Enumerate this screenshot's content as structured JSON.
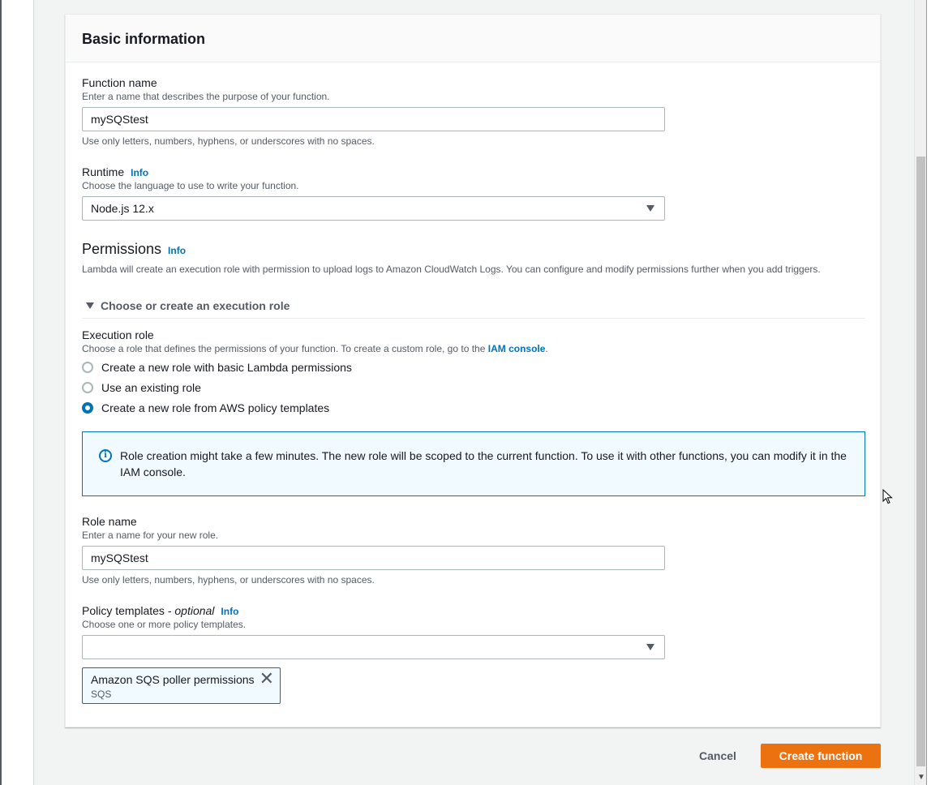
{
  "basic_info": {
    "title": "Basic information"
  },
  "function_name": {
    "label": "Function name",
    "description": "Enter a name that describes the purpose of your function.",
    "value": "mySQStest",
    "constraint": "Use only letters, numbers, hyphens, or underscores with no spaces."
  },
  "runtime": {
    "label": "Runtime",
    "info": "Info",
    "description": "Choose the language to use to write your function.",
    "value": "Node.js 12.x"
  },
  "permissions": {
    "title": "Permissions",
    "info": "Info",
    "description": "Lambda will create an execution role with permission to upload logs to Amazon CloudWatch Logs. You can configure and modify permissions further when you add triggers.",
    "expander_label": "Choose or create an execution role"
  },
  "execution_role": {
    "label": "Execution role",
    "description_prefix": "Choose a role that defines the permissions of your function. To create a custom role, go to the ",
    "description_link": "IAM console",
    "description_suffix": ".",
    "options": [
      {
        "label": "Create a new role with basic Lambda permissions",
        "selected": false
      },
      {
        "label": "Use an existing role",
        "selected": false
      },
      {
        "label": "Create a new role from AWS policy templates",
        "selected": true
      }
    ]
  },
  "alert": {
    "text": "Role creation might take a few minutes. The new role will be scoped to the current function. To use it with other functions, you can modify it in the IAM console."
  },
  "role_name": {
    "label": "Role name",
    "description": "Enter a name for your new role.",
    "value": "mySQStest",
    "constraint": "Use only letters, numbers, hyphens, or underscores with no spaces."
  },
  "policy_templates": {
    "label": "Policy templates - ",
    "label_optional": "optional",
    "info": "Info",
    "description": "Choose one or more policy templates.",
    "value": "",
    "selected_tokens": [
      {
        "label": "Amazon SQS poller permissions",
        "sub": "SQS"
      }
    ]
  },
  "footer": {
    "cancel_label": "Cancel",
    "create_label": "Create function"
  },
  "colors": {
    "accent": "#0073bb",
    "primary_button": "#ec7211"
  }
}
